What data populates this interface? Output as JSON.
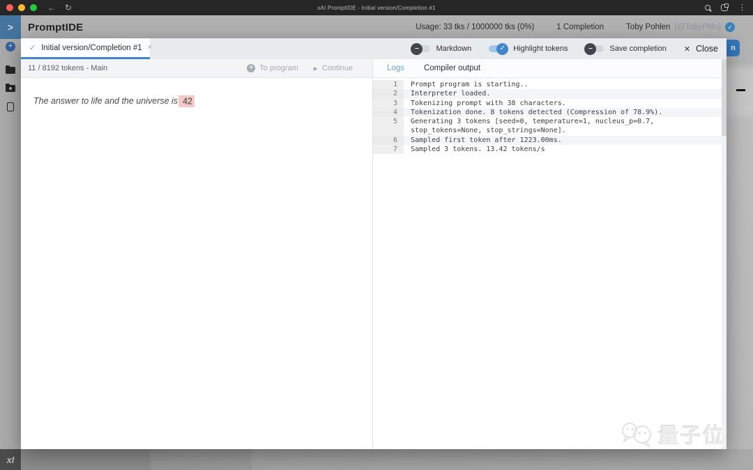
{
  "chrome": {
    "title": "xAI PromptIDE - Initial version/Completion #1"
  },
  "icons": {
    "back": "←",
    "reload": "↻",
    "kebab": "⋮",
    "chevron": ">",
    "check": "✓",
    "minus": "–",
    "close_x": "✕",
    "tab_close": "×",
    "plus": "+",
    "play": "▶"
  },
  "header": {
    "app_title": "PromptIDE",
    "usage": "Usage: 33 tks / 1000000 tks (0%)",
    "completions": "1 Completion",
    "user_name": "Toby Pohlen",
    "user_handle": "(@TobyPhln)"
  },
  "modal": {
    "tab_label": "Initial version/Completion #1",
    "toolbar": {
      "markdown": "Markdown",
      "highlight_tokens": "Highlight tokens",
      "save_completion": "Save completion",
      "close": "Close"
    },
    "editor": {
      "info": "11 / 8192 tokens - Main",
      "to_program": "To program",
      "continue": "Continue",
      "prompt_text": "The answer to life and the universe is",
      "completion_token": "42"
    },
    "logs": {
      "tab_logs": "Logs",
      "tab_compiler": "Compiler output",
      "lines": [
        {
          "num": "1",
          "text": "Prompt program is starting.."
        },
        {
          "num": "2",
          "text": "Interpreter loaded."
        },
        {
          "num": "3",
          "text": "Tokenizing prompt with 38 characters."
        },
        {
          "num": "4",
          "text": "Tokenization done. 8 tokens detected (Compression of 78.9%)."
        },
        {
          "num": "5",
          "text": "Generating 3 tokens [seed=0, temperature=1, nucleus_p=0.7,"
        },
        {
          "num": "",
          "text": "stop_tokens=None, stop_strings=None]."
        },
        {
          "num": "6",
          "text": "Sampled first token after 1223.00ms."
        },
        {
          "num": "7",
          "text": "Sampled 3 tokens. 13.42 tokens/s"
        }
      ]
    }
  },
  "background": {
    "run_button_fragment": "n",
    "xai_logo": "xI"
  },
  "watermark": {
    "text": "量子位"
  },
  "colors": {
    "accent_blue": "#4285c4",
    "token_highlight": "#f3cac8",
    "chrome_bg": "#262626",
    "traffic_red": "#ff5f57",
    "traffic_yellow": "#febc2e",
    "traffic_green": "#28c840",
    "dim_gray": "#b2b2b2"
  }
}
